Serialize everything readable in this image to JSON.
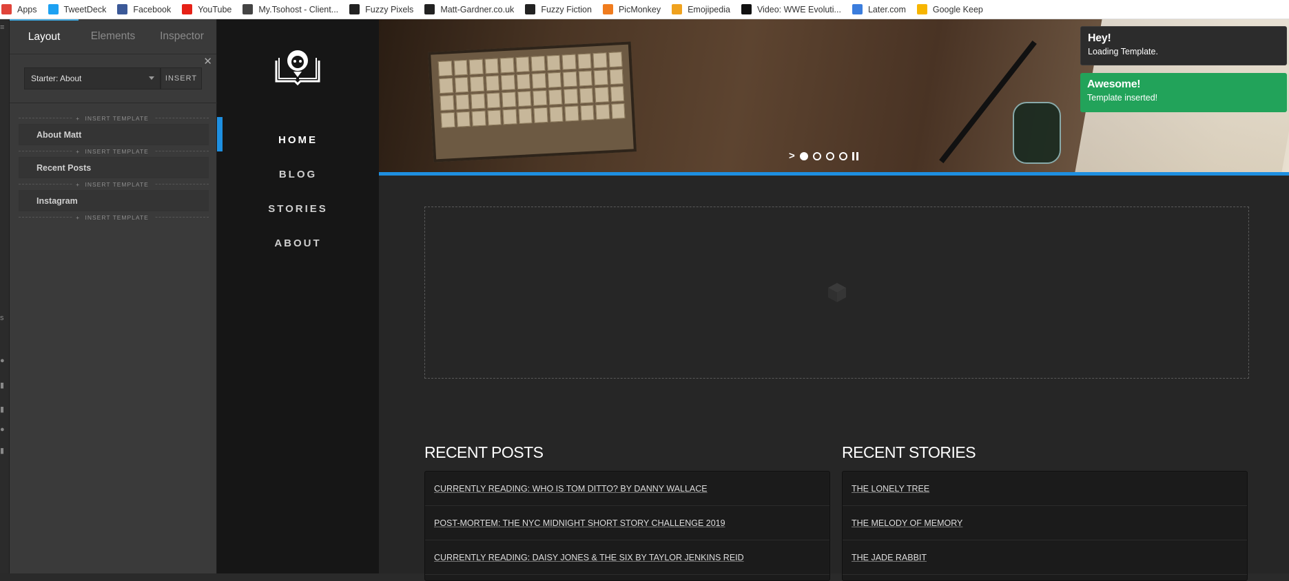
{
  "bookmarks": [
    {
      "label": "Apps",
      "icon": "apps-icon",
      "color": "#e0443a"
    },
    {
      "label": "TweetDeck",
      "icon": "tweetdeck-icon",
      "color": "#1da1f2"
    },
    {
      "label": "Facebook",
      "icon": "facebook-icon",
      "color": "#3b5998"
    },
    {
      "label": "YouTube",
      "icon": "youtube-icon",
      "color": "#e62117"
    },
    {
      "label": "My.Tsohost - Client...",
      "icon": "tsohost-icon",
      "color": "#444444"
    },
    {
      "label": "Fuzzy Pixels",
      "icon": "fuzzy-pixels-icon",
      "color": "#222222"
    },
    {
      "label": "Matt-Gardner.co.uk",
      "icon": "matt-gardner-icon",
      "color": "#222222"
    },
    {
      "label": "Fuzzy Fiction",
      "icon": "fuzzy-fiction-icon",
      "color": "#222222"
    },
    {
      "label": "PicMonkey",
      "icon": "picmonkey-icon",
      "color": "#f07c1e"
    },
    {
      "label": "Emojipedia",
      "icon": "emojipedia-icon",
      "color": "#f0a21e"
    },
    {
      "label": "Video: WWE Evoluti...",
      "icon": "wwe-icon",
      "color": "#111111"
    },
    {
      "label": "Later.com",
      "icon": "later-icon",
      "color": "#3b7ddd"
    },
    {
      "label": "Google Keep",
      "icon": "google-keep-icon",
      "color": "#f7b500"
    }
  ],
  "editor": {
    "tabs": [
      "Layout",
      "Elements",
      "Inspector"
    ],
    "active_tab": "Layout",
    "template_select": "Starter: About",
    "insert_label": "INSERT",
    "insert_template_label": "INSERT TEMPLATE",
    "templates": [
      "About Matt",
      "Recent Posts",
      "Instagram"
    ]
  },
  "site": {
    "nav": [
      "HOME",
      "BLOG",
      "STORIES",
      "ABOUT"
    ],
    "active_nav": "HOME",
    "accent": "#1e8fe0"
  },
  "main": {
    "recent_posts_title": "RECENT POSTS",
    "recent_stories_title": "RECENT STORIES",
    "posts": [
      "CURRENTLY READING: WHO IS TOM DITTO? BY DANNY WALLACE",
      "POST-MORTEM: THE NYC MIDNIGHT SHORT STORY CHALLENGE 2019",
      "CURRENTLY READING: DAISY JONES & THE SIX BY TAYLOR JENKINS REID"
    ],
    "stories": [
      "THE LONELY TREE",
      "THE MELODY OF MEMORY",
      "THE JADE RABBIT"
    ]
  },
  "toasts": [
    {
      "title": "Hey!",
      "message": "Loading Template.",
      "color": "#2c2c2c"
    },
    {
      "title": "Awesome!",
      "message": "Template inserted!",
      "color": "#22a35a"
    }
  ]
}
